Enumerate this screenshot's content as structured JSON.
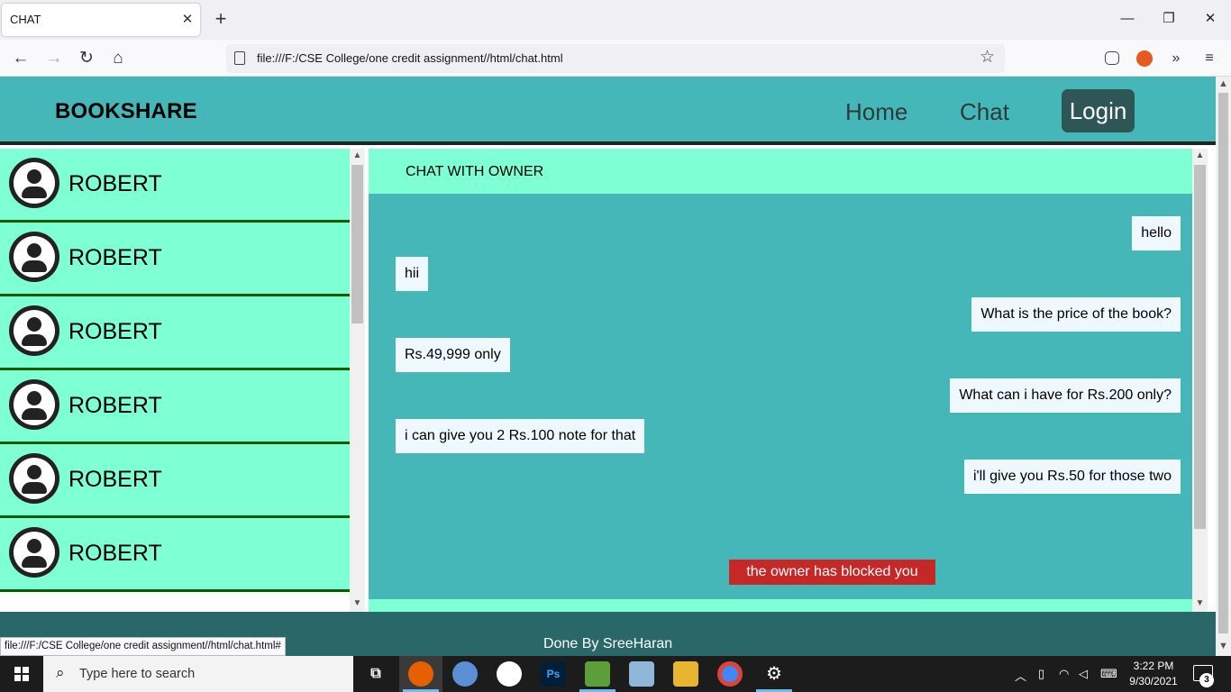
{
  "browser": {
    "tab_title": "CHAT",
    "tab_close": "✕",
    "new_tab": "+",
    "url": "file:///F:/CSE College/one credit assignment//html/chat.html",
    "status_url": "file:///F:/CSE College/one credit assignment//html/chat.html#",
    "window_controls": {
      "minimize": "—",
      "maximize": "❐",
      "close": "✕"
    },
    "nav": {
      "back": "←",
      "forward": "→",
      "reload": "↻",
      "home": "⌂"
    },
    "star": "☆",
    "toolbar": {
      "extensions": "»",
      "menu": "≡"
    }
  },
  "site": {
    "brand": "BOOKSHARE",
    "nav": {
      "home": "Home",
      "chat": "Chat",
      "login": "Login"
    },
    "contacts": [
      "ROBERT",
      "ROBERT",
      "ROBERT",
      "ROBERT",
      "ROBERT",
      "ROBERT"
    ],
    "chat": {
      "title": "CHAT WITH OWNER",
      "messages": [
        {
          "side": "sent",
          "text": "hello"
        },
        {
          "side": "recv",
          "text": "hii"
        },
        {
          "side": "sent",
          "text": "What is the price of the book?"
        },
        {
          "side": "recv",
          "text": "Rs.49,999 only"
        },
        {
          "side": "sent",
          "text": "What can i have for Rs.200 only?"
        },
        {
          "side": "recv",
          "text": "i can give you 2 Rs.100 note for that"
        },
        {
          "side": "sent",
          "text": "i'll give you Rs.50 for those two"
        }
      ],
      "blocked_notice": "the owner has blocked you"
    },
    "footer": "Done By SreeHaran"
  },
  "taskbar": {
    "search_placeholder": "Type here to search",
    "time": "3:22 PM",
    "date": "9/30/2021",
    "notifications": "3"
  },
  "colors": {
    "header": "#46b7b9",
    "accent_light": "#7fffd4",
    "contact_border": "#0a5c00",
    "login_button": "#2f5656",
    "footer": "#2a6768",
    "blocked": "#c62828",
    "bubble": "#f0f8ff"
  }
}
